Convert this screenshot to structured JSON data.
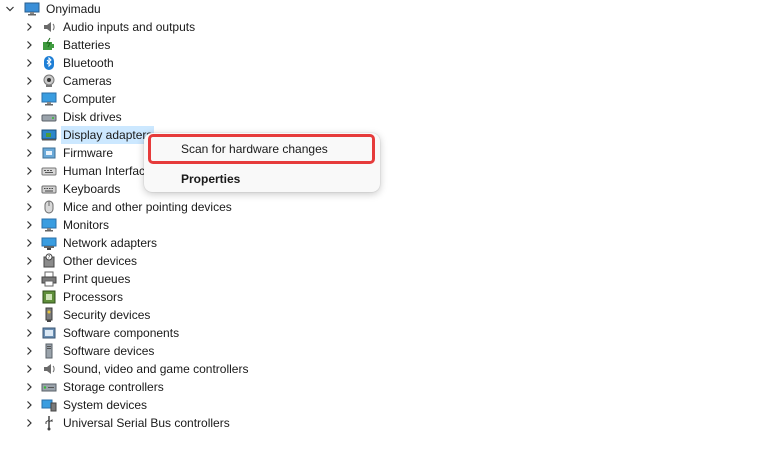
{
  "tree": {
    "root_label": "Onyimadu",
    "categories": [
      {
        "label": "Audio inputs and outputs",
        "icon": "speaker-icon"
      },
      {
        "label": "Batteries",
        "icon": "battery-icon"
      },
      {
        "label": "Bluetooth",
        "icon": "bluetooth-icon"
      },
      {
        "label": "Cameras",
        "icon": "camera-icon"
      },
      {
        "label": "Computer",
        "icon": "computer-icon"
      },
      {
        "label": "Disk drives",
        "icon": "disk-drive-icon"
      },
      {
        "label": "Display adapters",
        "icon": "display-adapter-icon",
        "selected": true
      },
      {
        "label": "Firmware",
        "icon": "firmware-icon"
      },
      {
        "label": "Human Interfac",
        "icon": "human-interface-icon"
      },
      {
        "label": "Keyboards",
        "icon": "keyboard-icon"
      },
      {
        "label": "Mice and other pointing devices",
        "icon": "mouse-icon"
      },
      {
        "label": "Monitors",
        "icon": "monitor-icon"
      },
      {
        "label": "Network adapters",
        "icon": "network-adapter-icon"
      },
      {
        "label": "Other devices",
        "icon": "unknown-device-icon"
      },
      {
        "label": "Print queues",
        "icon": "printer-icon"
      },
      {
        "label": "Processors",
        "icon": "processor-icon"
      },
      {
        "label": "Security devices",
        "icon": "security-device-icon"
      },
      {
        "label": "Software components",
        "icon": "software-component-icon"
      },
      {
        "label": "Software devices",
        "icon": "software-device-icon"
      },
      {
        "label": "Sound, video and game controllers",
        "icon": "sound-icon"
      },
      {
        "label": "Storage controllers",
        "icon": "storage-controller-icon"
      },
      {
        "label": "System devices",
        "icon": "system-device-icon"
      },
      {
        "label": "Universal Serial Bus controllers",
        "icon": "usb-icon"
      }
    ]
  },
  "context_menu": {
    "items": [
      "Scan for hardware changes",
      "Properties"
    ]
  },
  "colors": {
    "selection": "#cce8ff",
    "highlight_border": "#e63b3b"
  }
}
